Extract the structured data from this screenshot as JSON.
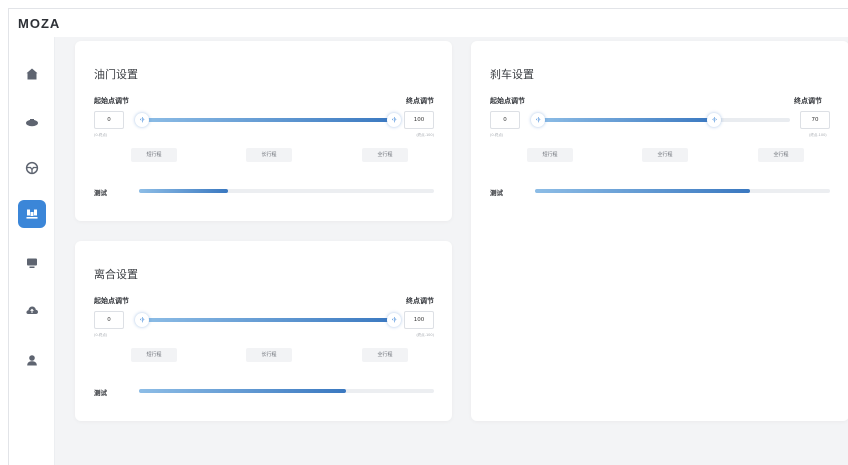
{
  "app": {
    "logo": "MOZA"
  },
  "sidebar": {
    "items": [
      {
        "icon": "home-icon",
        "active": false
      },
      {
        "icon": "motor-icon",
        "active": false
      },
      {
        "icon": "steering-wheel-icon",
        "active": false
      },
      {
        "icon": "pedals-icon",
        "active": true
      },
      {
        "icon": "dashboard-icon",
        "active": false
      },
      {
        "icon": "cloud-upload-icon",
        "active": false
      },
      {
        "icon": "user-icon",
        "active": false
      }
    ]
  },
  "throttle": {
    "title": "油门设置",
    "start_label": "起始点调节",
    "end_label": "终点调节",
    "start_value": "0",
    "end_value": "100",
    "start_hint": "(0-终点)",
    "end_hint": "(终点-100)",
    "slider": {
      "start": 0,
      "end": 100
    },
    "presets": [
      "短行程",
      "长行程",
      "全行程"
    ],
    "test_label": "测试",
    "test_fraction": 0.3
  },
  "clutch": {
    "title": "离合设置",
    "start_label": "起始点调节",
    "end_label": "终点调节",
    "start_value": "0",
    "end_value": "100",
    "start_hint": "(0-终点)",
    "end_hint": "(终点-100)",
    "slider": {
      "start": 0,
      "end": 100
    },
    "presets": [
      "短行程",
      "长行程",
      "全行程"
    ],
    "test_label": "测试",
    "test_fraction": 0.7
  },
  "brake": {
    "title": "刹车设置",
    "start_label": "起始点调节",
    "end_label": "终点调节",
    "start_value": "0",
    "end_value": "70",
    "start_hint": "(0-终点)",
    "end_hint": "(终点-100)",
    "slider": {
      "start": 0,
      "end": 70
    },
    "presets": [
      "短行程",
      "全行程",
      "全行程"
    ],
    "test_label": "测试",
    "test_fraction": 0.73
  },
  "colors": {
    "accent": "#3b86d8",
    "icon": "#5e6470"
  }
}
